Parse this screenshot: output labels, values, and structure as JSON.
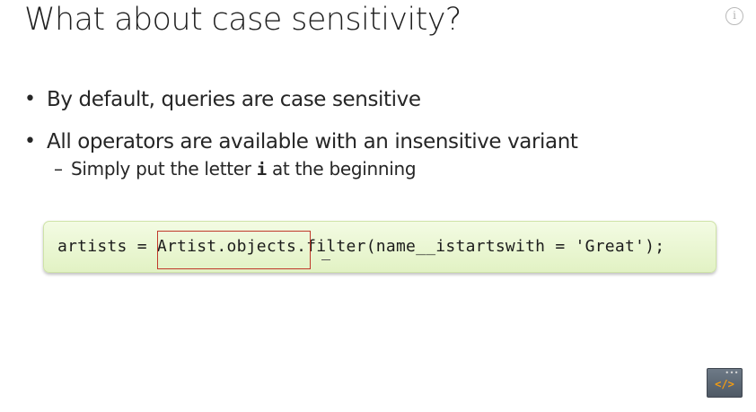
{
  "slide": {
    "title": "What about case sensitivity?",
    "info_icon_glyph": "i",
    "bullets": [
      {
        "text": "By default, queries are case sensitive"
      },
      {
        "text": "All operators are available with an insensitive variant"
      }
    ],
    "sub_bullet": {
      "dash": "–",
      "before": "Simply put the letter ",
      "letter": "i",
      "after": " at the beginning"
    },
    "bullet_glyph": "•",
    "code": {
      "line": "artists = Artist.objects.filter(name__istartswith = 'Great');",
      "highlighted_segment": "Artist.objects"
    },
    "code_icon": {
      "glyph": "</>",
      "dots": "•••"
    }
  },
  "colors": {
    "code_box_bg": "#e7f5cc",
    "highlight_border": "#c0392b",
    "code_icon_bg": "#5f6b78",
    "code_icon_glyph": "#f39c12"
  }
}
